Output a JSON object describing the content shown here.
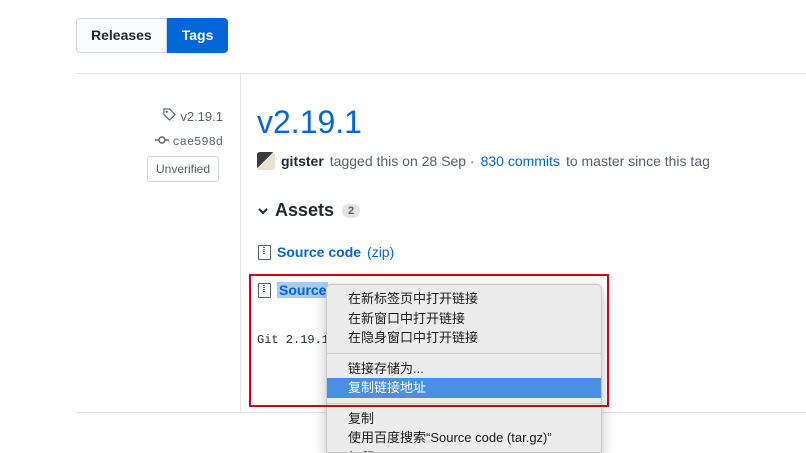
{
  "tabs": {
    "releases": "Releases",
    "tags": "Tags"
  },
  "sidebar": {
    "tag": "v2.19.1",
    "commit": "cae598d",
    "verification": "Unverified"
  },
  "release": {
    "title": "v2.19.1",
    "user": "gitster",
    "tagged_text": "tagged this on 28 Sep ·",
    "commits_link": "830 commits",
    "commits_suffix": "to master since this tag"
  },
  "assets": {
    "heading": "Assets",
    "count": "2",
    "items": [
      {
        "name": "Source code",
        "ext": "(zip)"
      },
      {
        "name": "Source"
      }
    ]
  },
  "body_text": "Git 2.19.1",
  "context_menu": {
    "items": [
      "在新标签页中打开链接",
      "在新窗口中打开链接",
      "在隐身窗口中打开链接",
      "链接存储为...",
      "复制链接地址",
      "复制",
      "使用百度搜索“Source code (tar.gz)”",
      "打印"
    ],
    "highlighted": "复制链接地址"
  },
  "colors": {
    "link": "#0366d6",
    "active_tab": "#0366d6",
    "highlight": "#4a90e2",
    "annotation": "#d0021b"
  }
}
